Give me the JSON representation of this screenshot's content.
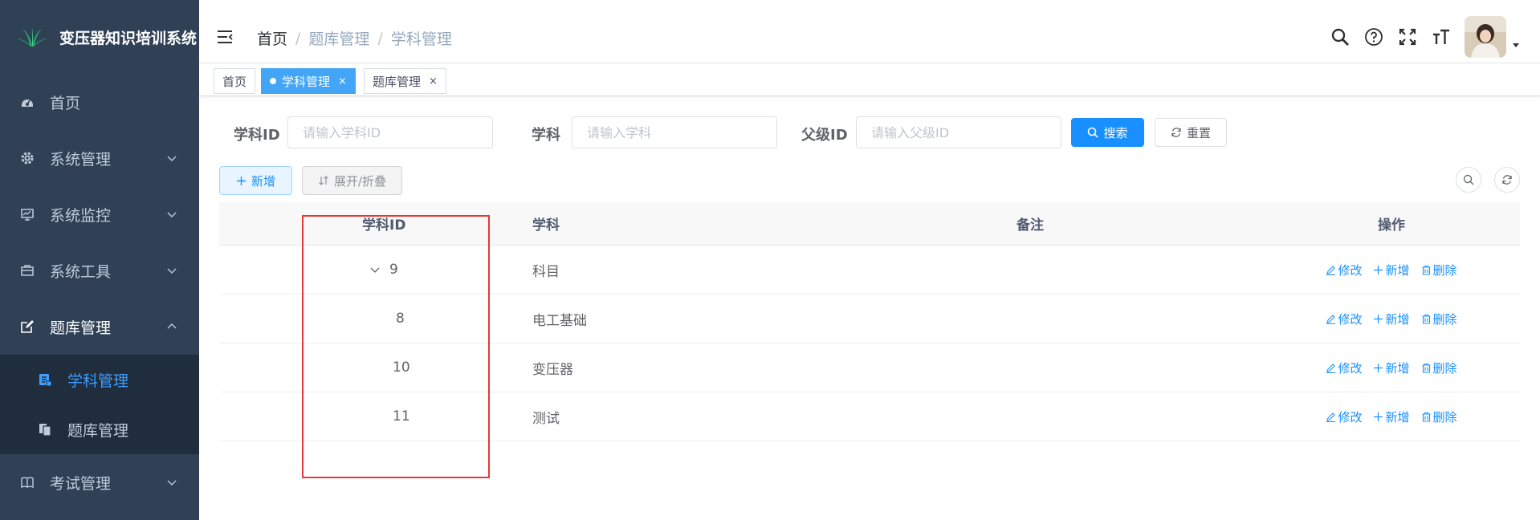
{
  "app": {
    "title": "变压器知识培训系统"
  },
  "sidebar": {
    "items": [
      {
        "label": "首页",
        "icon": "dashboard-icon"
      },
      {
        "label": "系统管理",
        "icon": "gear-icon"
      },
      {
        "label": "系统监控",
        "icon": "monitor-icon"
      },
      {
        "label": "系统工具",
        "icon": "toolbox-icon"
      },
      {
        "label": "题库管理",
        "icon": "edit-icon"
      },
      {
        "label": "考试管理",
        "icon": "book-icon"
      }
    ],
    "submenu": [
      {
        "label": "学科管理",
        "icon": "document-icon",
        "active": true
      },
      {
        "label": "题库管理",
        "icon": "copy-icon",
        "active": false
      }
    ]
  },
  "header": {
    "breadcrumb": [
      "首页",
      "题库管理",
      "学科管理"
    ],
    "breadcrumb_sep": "/"
  },
  "tags": [
    {
      "label": "首页",
      "active": false,
      "closable": false
    },
    {
      "label": "学科管理",
      "active": true,
      "closable": true
    },
    {
      "label": "题库管理",
      "active": false,
      "closable": true
    }
  ],
  "tag_close": "×",
  "search": {
    "subject_id_label": "学科ID",
    "subject_id_placeholder": "请输入学科ID",
    "subject_label": "学科",
    "subject_placeholder": "请输入学科",
    "parent_id_label": "父级ID",
    "parent_id_placeholder": "请输入父级ID",
    "search_button": "搜索",
    "reset_button": "重置"
  },
  "toolbar": {
    "add_button": "新增",
    "expand_button": "展开/折叠"
  },
  "table": {
    "columns": [
      "学科ID",
      "学科",
      "备注",
      "操作"
    ],
    "rows": [
      {
        "id": "9",
        "name": "科目",
        "note": "",
        "has_children": true
      },
      {
        "id": "8",
        "name": "电工基础",
        "note": "",
        "has_children": false
      },
      {
        "id": "10",
        "name": "变压器",
        "note": "",
        "has_children": false
      },
      {
        "id": "11",
        "name": "测试",
        "note": "",
        "has_children": false
      }
    ],
    "actions": {
      "edit": "修改",
      "add": "新增",
      "delete": "删除"
    }
  },
  "colors": {
    "sidebar_bg": "#304156",
    "submenu_bg": "#1f2d3d",
    "primary": "#1890ff",
    "active_tag": "#42a5f5",
    "highlight": "#e53935"
  }
}
